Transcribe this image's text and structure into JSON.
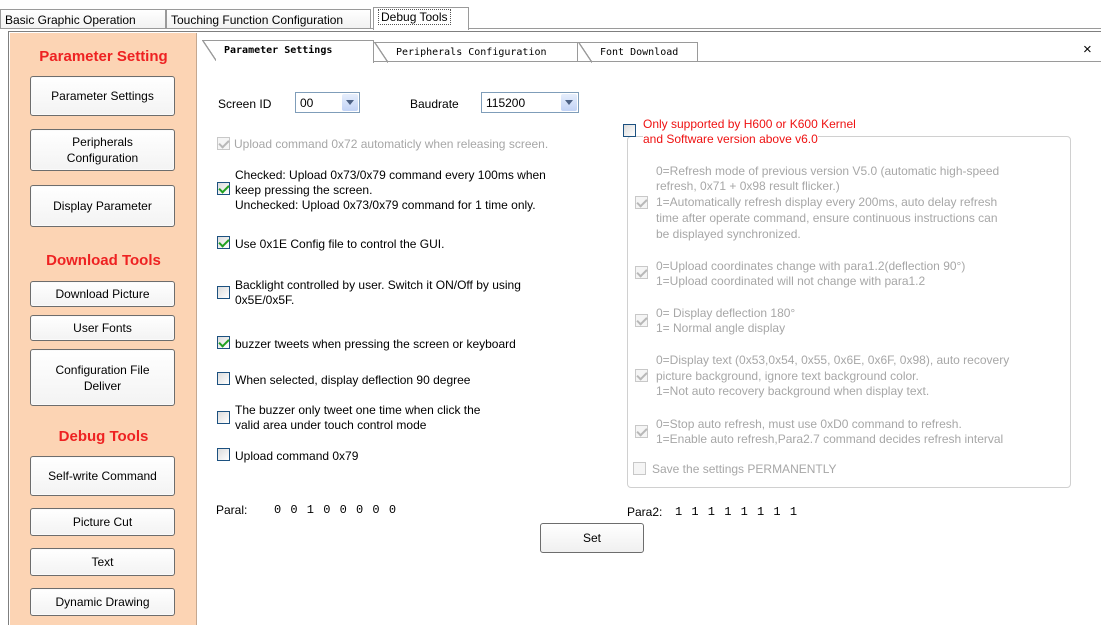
{
  "top_tabs": [
    {
      "label": "Basic Graphic Operation"
    },
    {
      "label": "Touching Function Configuration"
    },
    {
      "label": "Debug Tools"
    }
  ],
  "sidebar": {
    "parameter_heading": "Parameter Setting",
    "download_heading": "Download Tools",
    "debug_heading": "Debug Tools",
    "buttons": {
      "parameter_settings": "Parameter Settings",
      "peripherals_1": "Peripherals",
      "peripherals_2": "Configuration",
      "display_parameter": "Display Parameter",
      "download_picture": "Download Picture",
      "user_fonts": "User Fonts",
      "config_file_1": "Configuration File",
      "config_file_2": "Deliver",
      "self_write": "Self-write Command",
      "picture_cut": "Picture Cut",
      "text": "Text",
      "dynamic_drawing": "Dynamic Drawing"
    }
  },
  "inner_tabs": [
    {
      "label": "Parameter Settings"
    },
    {
      "label": "Peripherals Configuration"
    },
    {
      "label": "Font Download"
    }
  ],
  "close_glyph": "×",
  "screen_id": {
    "label": "Screen ID",
    "value": "00"
  },
  "baudrate": {
    "label": "Baudrate",
    "value": "115200"
  },
  "left_options": {
    "upload_0x72": {
      "text": "Upload command 0x72 automaticly when  releasing screen.",
      "checked": true,
      "disabled": true
    },
    "upload_0x73": {
      "line1": "Checked: Upload 0x73/0x79 command every 100ms when",
      "line2": "keep pressing the screen.",
      "line3": "Unchecked: Upload 0x73/0x79 command for 1 time only.",
      "checked": true
    },
    "config_file": {
      "text": "Use 0x1E Config file to control the GUI.",
      "checked": true
    },
    "backlight": {
      "line1": "Backlight controlled by user. Switch it ON/Off by using",
      "line2": "0x5E/0x5F.",
      "checked": false
    },
    "buzzer": {
      "text": "buzzer tweets when pressing the screen or keyboard",
      "checked": true
    },
    "deflection90": {
      "text": "When selected, display deflection 90 degree",
      "checked": false
    },
    "buzzer_once": {
      "line1": "The buzzer only tweet one time when click the",
      "line2": "valid area under touch control mode",
      "checked": false
    },
    "upload_0x79": {
      "text": "Upload command 0x79",
      "checked": false
    }
  },
  "para1": {
    "label": "Paral:",
    "value": "0 0 1 0 0 0 0 0"
  },
  "para2": {
    "label": "Para2:",
    "value": "1 1 1 1 1 1 1 1"
  },
  "right_options": {
    "kernel_note": {
      "line1": "Only supported by H600 or K600 Kernel",
      "line2": "and Software version above v6.0",
      "checked": false
    },
    "refresh_mode": {
      "line1": "0=Refresh mode of previous version V5.0 (automatic high-speed",
      "line2": "refresh, 0x71 + 0x98 result flicker.)",
      "line3": "1=Automatically refresh display every 200ms, auto delay refresh",
      "line4": "time after operate command, ensure continuous instructions can",
      "line5": "be displayed synchronized.",
      "checked": true
    },
    "coordinates": {
      "line1": "0=Upload coordinates change with para1.2(deflection 90°)",
      "line2": "1=Upload coordinated will not change with para1.2",
      "checked": true
    },
    "deflection180": {
      "line1": "0= Display deflection 180°",
      "line2": "1= Normal angle display",
      "checked": true
    },
    "display_text": {
      "line1": "0=Display text (0x53,0x54, 0x55, 0x6E, 0x6F, 0x98), auto recovery",
      "line2": "picture background, ignore text background color.",
      "line3": "1=Not auto recovery background when display text.",
      "checked": true
    },
    "auto_refresh": {
      "line1": "0=Stop auto refresh, must use 0xD0 command to refresh.",
      "line2": "1=Enable auto refresh,Para2.7 command decides refresh interval",
      "checked": true
    },
    "save_permanently": {
      "text": "Save the settings PERMANENTLY",
      "checked": false
    }
  },
  "set_button": "Set"
}
